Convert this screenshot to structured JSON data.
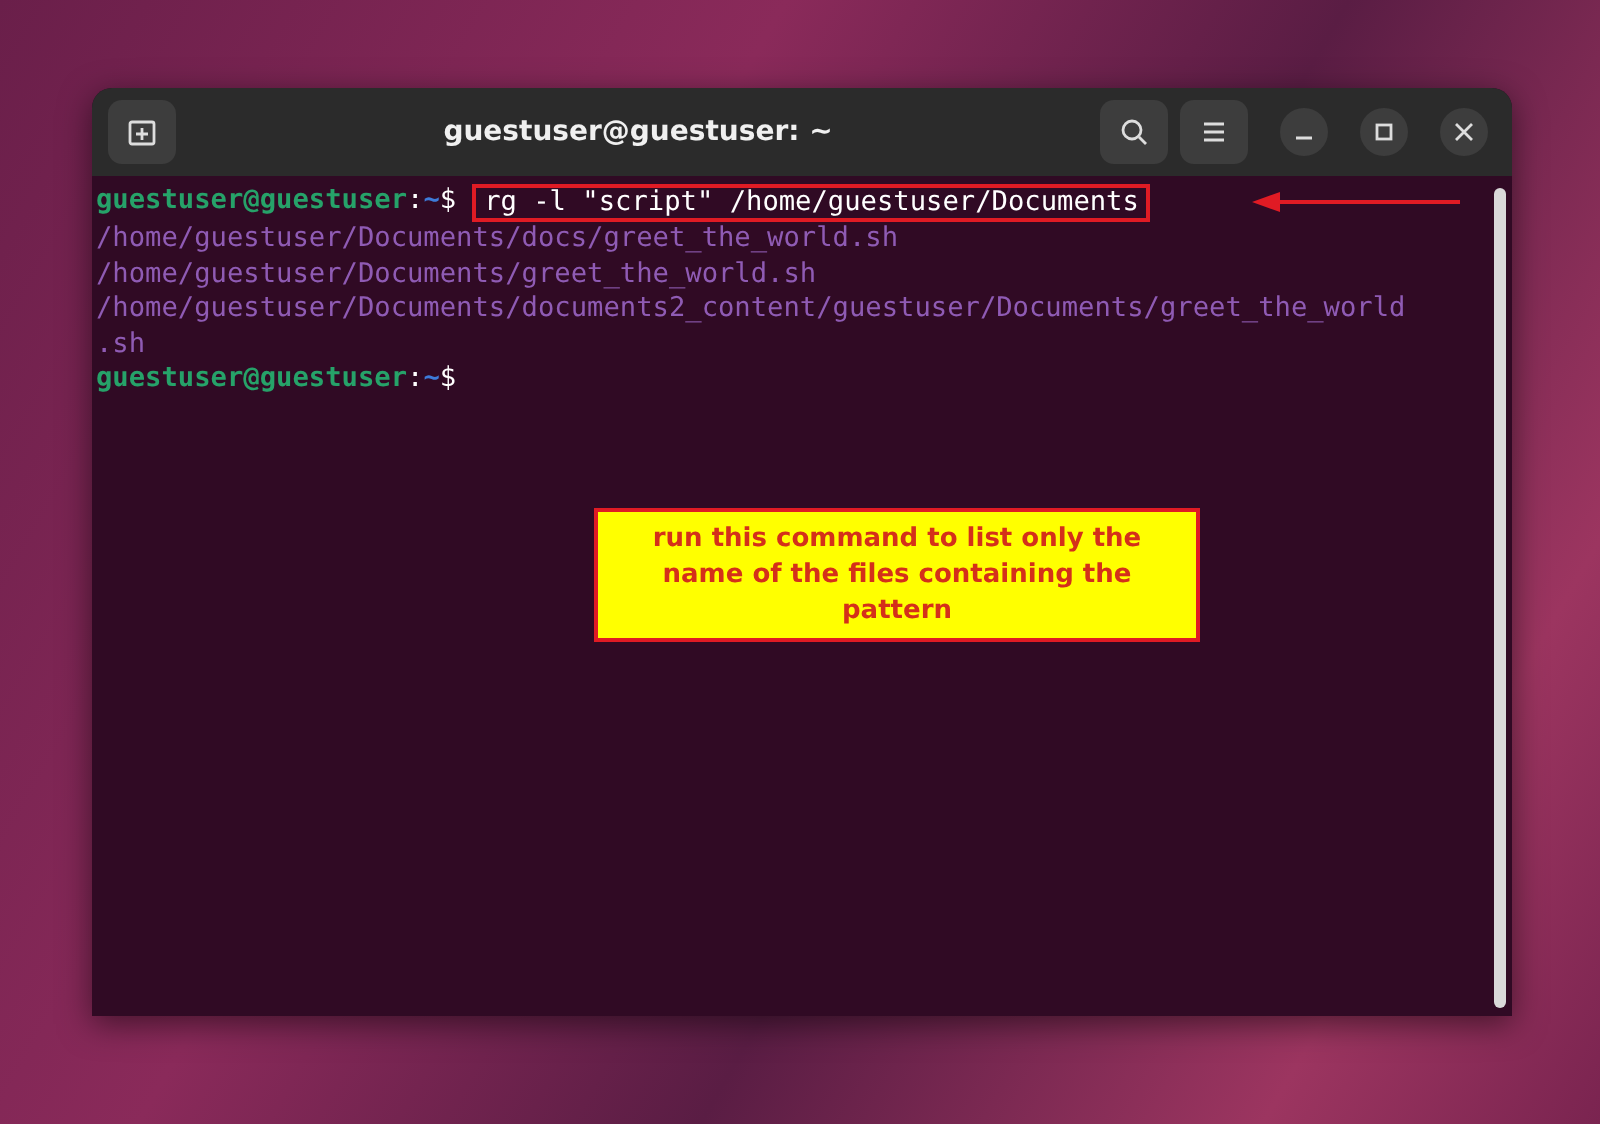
{
  "window": {
    "title": "guestuser@guestuser: ~"
  },
  "terminal": {
    "lines": [
      {
        "kind": "prompt",
        "user_host": "guestuser@guestuser",
        "separator": ":",
        "path": "~",
        "symbol": "$",
        "command": "rg -l \"script\" /home/guestuser/Documents",
        "highlighted": true
      },
      {
        "kind": "output",
        "text": "/home/guestuser/Documents/docs/greet_the_world.sh"
      },
      {
        "kind": "output",
        "text": "/home/guestuser/Documents/greet_the_world.sh"
      },
      {
        "kind": "output",
        "text": "/home/guestuser/Documents/documents2_content/guestuser/Documents/greet_the_world"
      },
      {
        "kind": "output",
        "text": ".sh"
      },
      {
        "kind": "prompt",
        "user_host": "guestuser@guestuser",
        "separator": ":",
        "path": "~",
        "symbol": "$"
      }
    ]
  },
  "annotation": {
    "text": "run this command to list only the name of the files containing the pattern"
  }
}
